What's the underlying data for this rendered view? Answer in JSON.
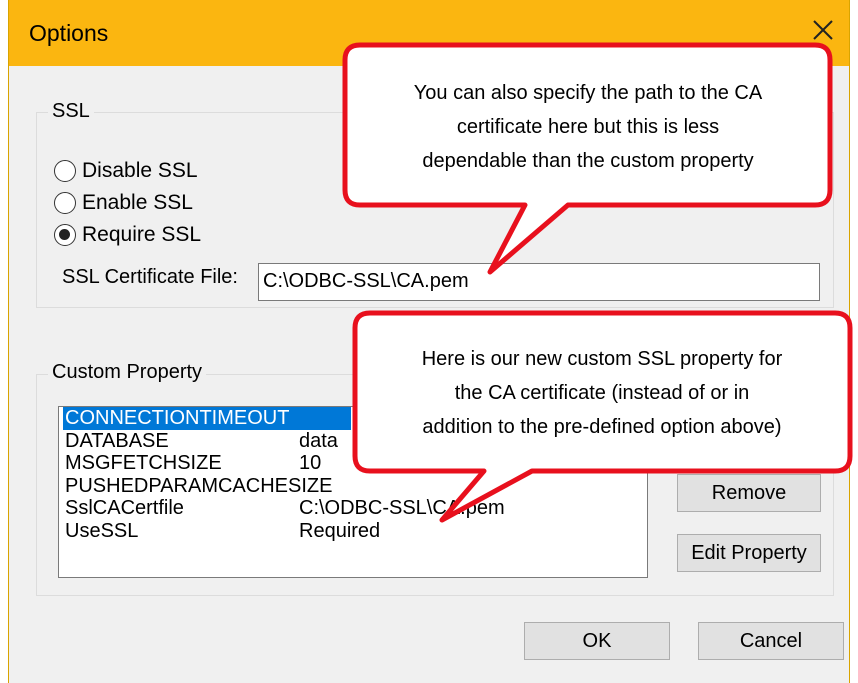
{
  "window": {
    "title": "Options"
  },
  "ssl": {
    "group_label": "SSL",
    "radio_disable": "Disable SSL",
    "radio_enable": "Enable SSL",
    "radio_require": "Require SSL",
    "selected": "Require SSL",
    "cert_file_label": "SSL Certificate File:",
    "cert_file_value": "C:\\ODBC-SSL\\CA.pem"
  },
  "custom": {
    "group_label": "Custom Property",
    "rows": [
      {
        "name": "CONNECTIONTIMEOUT",
        "value": "",
        "selected": true
      },
      {
        "name": "DATABASE",
        "value": "data"
      },
      {
        "name": "MSGFETCHSIZE",
        "value": "10"
      },
      {
        "name": "PUSHEDPARAMCACHESIZE",
        "value": ""
      },
      {
        "name": "SslCACertfile",
        "value": "C:\\ODBC-SSL\\CA.pem"
      },
      {
        "name": "UseSSL",
        "value": "Required"
      }
    ],
    "remove_label": "Remove",
    "edit_label": "Edit Property"
  },
  "footer": {
    "ok_label": "OK",
    "cancel_label": "Cancel"
  },
  "callouts": {
    "top": [
      "You can also specify the path to the CA",
      "certificate here but this is less",
      "dependable than the custom property"
    ],
    "bottom": [
      "Here is our new custom SSL property for",
      "the CA certificate (instead of or in",
      "addition to the pre-defined option above)"
    ]
  },
  "colors": {
    "titlebar": "#fbb610",
    "selection": "#0078d7",
    "callout_border": "#e8101d"
  },
  "icons": {
    "close": "close-icon"
  }
}
